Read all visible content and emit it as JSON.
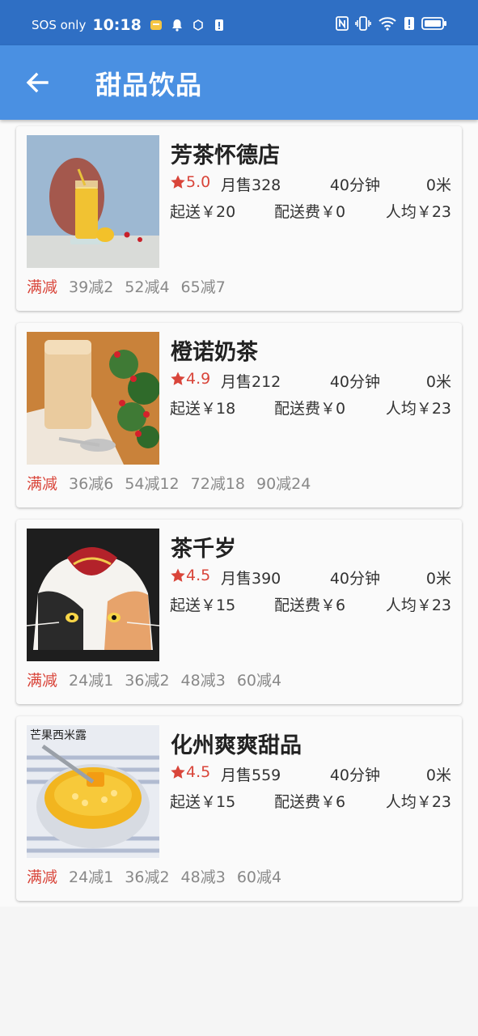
{
  "status_bar": {
    "carrier": "SOS only",
    "time": "10:18"
  },
  "app_bar": {
    "title": "甜品饮品"
  },
  "colors": {
    "status_bar": "#2f6fc4",
    "app_bar": "#4a90e2",
    "accent_red": "#d9453a"
  },
  "shops": [
    {
      "name": "芳茶怀德店",
      "rating": "5.0",
      "sales": "月售328",
      "time": "40分钟",
      "distance": "0米",
      "min_order": "起送￥20",
      "delivery_fee": "配送费￥0",
      "avg_price": "人均￥23",
      "promo_label": "满减",
      "promos": [
        "39减2",
        "52减4",
        "65减7"
      ]
    },
    {
      "name": "橙诺奶茶",
      "rating": "4.9",
      "sales": "月售212",
      "time": "40分钟",
      "distance": "0米",
      "min_order": "起送￥18",
      "delivery_fee": "配送费￥0",
      "avg_price": "人均￥23",
      "promo_label": "满减",
      "promos": [
        "36减6",
        "54减12",
        "72减18",
        "90减24"
      ]
    },
    {
      "name": "茶千岁",
      "rating": "4.5",
      "sales": "月售390",
      "time": "40分钟",
      "distance": "0米",
      "min_order": "起送￥15",
      "delivery_fee": "配送费￥6",
      "avg_price": "人均￥23",
      "promo_label": "满减",
      "promos": [
        "24减1",
        "36减2",
        "48减3",
        "60减4"
      ]
    },
    {
      "name": "化州爽爽甜品",
      "rating": "4.5",
      "sales": "月售559",
      "time": "40分钟",
      "distance": "0米",
      "min_order": "起送￥15",
      "delivery_fee": "配送费￥6",
      "avg_price": "人均￥23",
      "promo_label": "满减",
      "promos": [
        "24减1",
        "36减2",
        "48减3",
        "60减4"
      ],
      "image_overlay_text": "芒果西米露"
    }
  ]
}
